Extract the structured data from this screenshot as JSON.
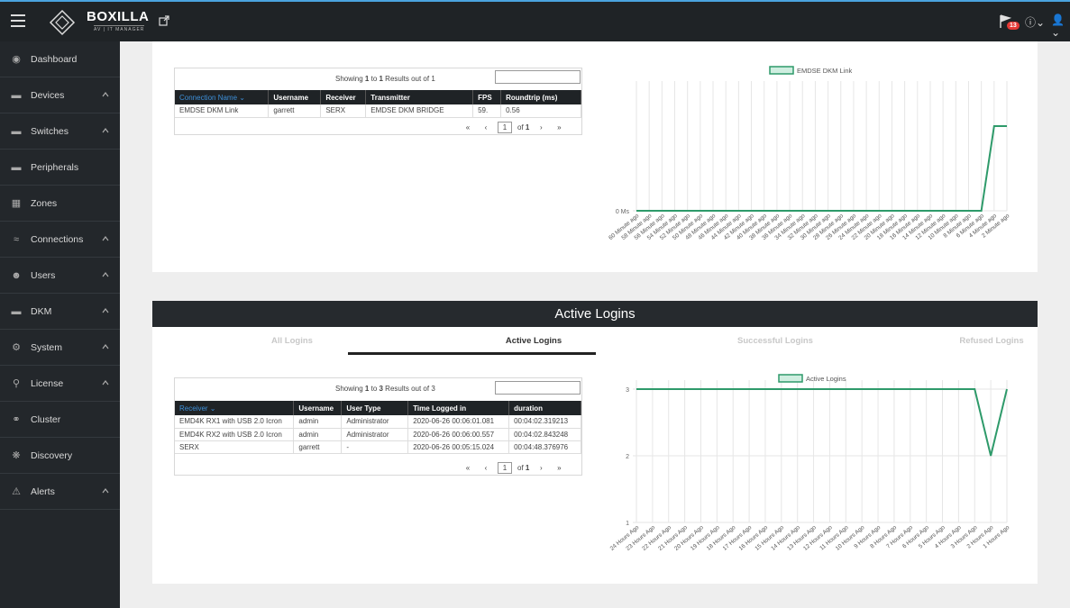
{
  "app": {
    "brand": "BOXILLA",
    "brand_sub": "AV | IT MANAGER",
    "alert_count": "13"
  },
  "sidebar": {
    "items": [
      {
        "label": "Dashboard",
        "icon": "dashboard-icon",
        "chevron": false
      },
      {
        "label": "Devices",
        "icon": "device-icon",
        "chevron": true
      },
      {
        "label": "Switches",
        "icon": "switch-icon",
        "chevron": true
      },
      {
        "label": "Peripherals",
        "icon": "peripheral-icon",
        "chevron": false
      },
      {
        "label": "Zones",
        "icon": "zones-icon",
        "chevron": false
      },
      {
        "label": "Connections",
        "icon": "wifi-icon",
        "chevron": true
      },
      {
        "label": "Users",
        "icon": "users-icon",
        "chevron": true
      },
      {
        "label": "DKM",
        "icon": "dkm-icon",
        "chevron": true
      },
      {
        "label": "System",
        "icon": "gear-icon",
        "chevron": true
      },
      {
        "label": "License",
        "icon": "key-icon",
        "chevron": true
      },
      {
        "label": "Cluster",
        "icon": "cluster-icon",
        "chevron": false
      },
      {
        "label": "Discovery",
        "icon": "discovery-icon",
        "chevron": false
      },
      {
        "label": "Alerts",
        "icon": "warning-icon",
        "chevron": true
      }
    ]
  },
  "connections_table": {
    "info_prefix": "Showing ",
    "info_from": "1",
    "info_mid": " to ",
    "info_to": "1",
    "info_suffix": " Results out of 1",
    "columns": [
      "Connection Name ⌄",
      "Username",
      "Receiver",
      "Transmitter",
      "FPS",
      "Roundtrip (ms)"
    ],
    "rows": [
      [
        "EMDSE DKM Link",
        "garrett",
        "SERX",
        "EMDSE DKM BRIDGE",
        "59.",
        "0.56"
      ]
    ],
    "page_current": "1",
    "page_of": "of",
    "page_total": "1"
  },
  "connection_chart": {
    "legend": "EMDSE DKM Link",
    "y_label_bottom": "0 Ms",
    "x_ticks": [
      "60 Minute ago",
      "58 Minute ago",
      "56 Minute ago",
      "54 Minute ago",
      "52 Minute ago",
      "50 Minute ago",
      "48 Minute ago",
      "46 Minute ago",
      "44 Minute ago",
      "42 Minute ago",
      "40 Minute ago",
      "38 Minute ago",
      "36 Minute ago",
      "34 Minute ago",
      "32 Minute ago",
      "30 Minute ago",
      "28 Minute ago",
      "26 Minute ago",
      "24 Minute ago",
      "22 Minute ago",
      "20 Minute ago",
      "18 Minute ago",
      "16 Minute ago",
      "14 Minute ago",
      "12 Minute ago",
      "10 Minute ago",
      "8 Minute ago",
      "6 Minute ago",
      "4 Minute ago",
      "2 Minute ago"
    ],
    "color": "#2e9a6a"
  },
  "active_logins": {
    "title": "Active Logins",
    "tabs": [
      "All Logins",
      "Active Logins",
      "Successful Logins",
      "Refused Logins"
    ],
    "active_tab": 1
  },
  "logins_table": {
    "info_prefix": "Showing ",
    "info_from": "1",
    "info_mid": " to ",
    "info_to": "3",
    "info_suffix": " Results out of 3",
    "columns": [
      "Receiver ⌄",
      "Username",
      "User Type",
      "Time Logged in",
      "duration"
    ],
    "rows": [
      [
        "EMD4K RX1 with USB 2.0 Icron",
        "admin",
        "Administrator",
        "2020-06-26 00:06:01.081",
        "00:04:02.319213"
      ],
      [
        "EMD4K RX2 with USB 2.0 Icron",
        "admin",
        "Administrator",
        "2020-06-26 00:06:00.557",
        "00:04:02.843248"
      ],
      [
        "SERX",
        "garrett",
        "-",
        "2020-06-26 00:05:15.024",
        "00:04:48.376976"
      ]
    ],
    "page_current": "1",
    "page_of": "of",
    "page_total": "1"
  },
  "chart_data": [
    {
      "type": "line",
      "title": "",
      "series": [
        {
          "name": "EMDSE DKM Link",
          "values": [
            0,
            0,
            0,
            0,
            0,
            0,
            0,
            0,
            0,
            0,
            0,
            0,
            0,
            0,
            0,
            0,
            0,
            0,
            0,
            0,
            0,
            0,
            0,
            0,
            0,
            0,
            0,
            0,
            1,
            1
          ]
        }
      ],
      "x": [
        "60 Minute ago",
        "58 Minute ago",
        "56 Minute ago",
        "54 Minute ago",
        "52 Minute ago",
        "50 Minute ago",
        "48 Minute ago",
        "46 Minute ago",
        "44 Minute ago",
        "42 Minute ago",
        "40 Minute ago",
        "38 Minute ago",
        "36 Minute ago",
        "34 Minute ago",
        "32 Minute ago",
        "30 Minute ago",
        "28 Minute ago",
        "26 Minute ago",
        "24 Minute ago",
        "22 Minute ago",
        "20 Minute ago",
        "18 Minute ago",
        "16 Minute ago",
        "14 Minute ago",
        "12 Minute ago",
        "10 Minute ago",
        "8 Minute ago",
        "6 Minute ago",
        "4 Minute ago",
        "2 Minute ago"
      ],
      "y_ticks": [
        "0 Ms"
      ],
      "grid": true,
      "legend": "top"
    },
    {
      "type": "line",
      "title": "",
      "series": [
        {
          "name": "Active Logins",
          "values": [
            3,
            3,
            3,
            3,
            3,
            3,
            3,
            3,
            3,
            3,
            3,
            3,
            3,
            3,
            3,
            3,
            3,
            3,
            3,
            3,
            3,
            3,
            2,
            3
          ]
        }
      ],
      "x": [
        "24 Hours Ago",
        "23 Hours Ago",
        "22 Hours Ago",
        "21 Hours Ago",
        "20 Hours Ago",
        "19 Hours Ago",
        "18 Hours Ago",
        "17 Hours Ago",
        "16 Hours Ago",
        "15 Hours Ago",
        "14 Hours Ago",
        "13 Hours Ago",
        "12 Hours Ago",
        "11 Hours Ago",
        "10 Hours Ago",
        "9 Hours Ago",
        "8 Hours Ago",
        "7 Hours Ago",
        "6 Hours Ago",
        "5 Hours Ago",
        "4 Hours Ago",
        "3 Hours Ago",
        "2 Hours Ago",
        "1 Hours Ago"
      ],
      "y_ticks": [
        "1",
        "2",
        "3"
      ],
      "ylim": [
        1,
        3
      ],
      "grid": true,
      "legend": "top"
    }
  ]
}
